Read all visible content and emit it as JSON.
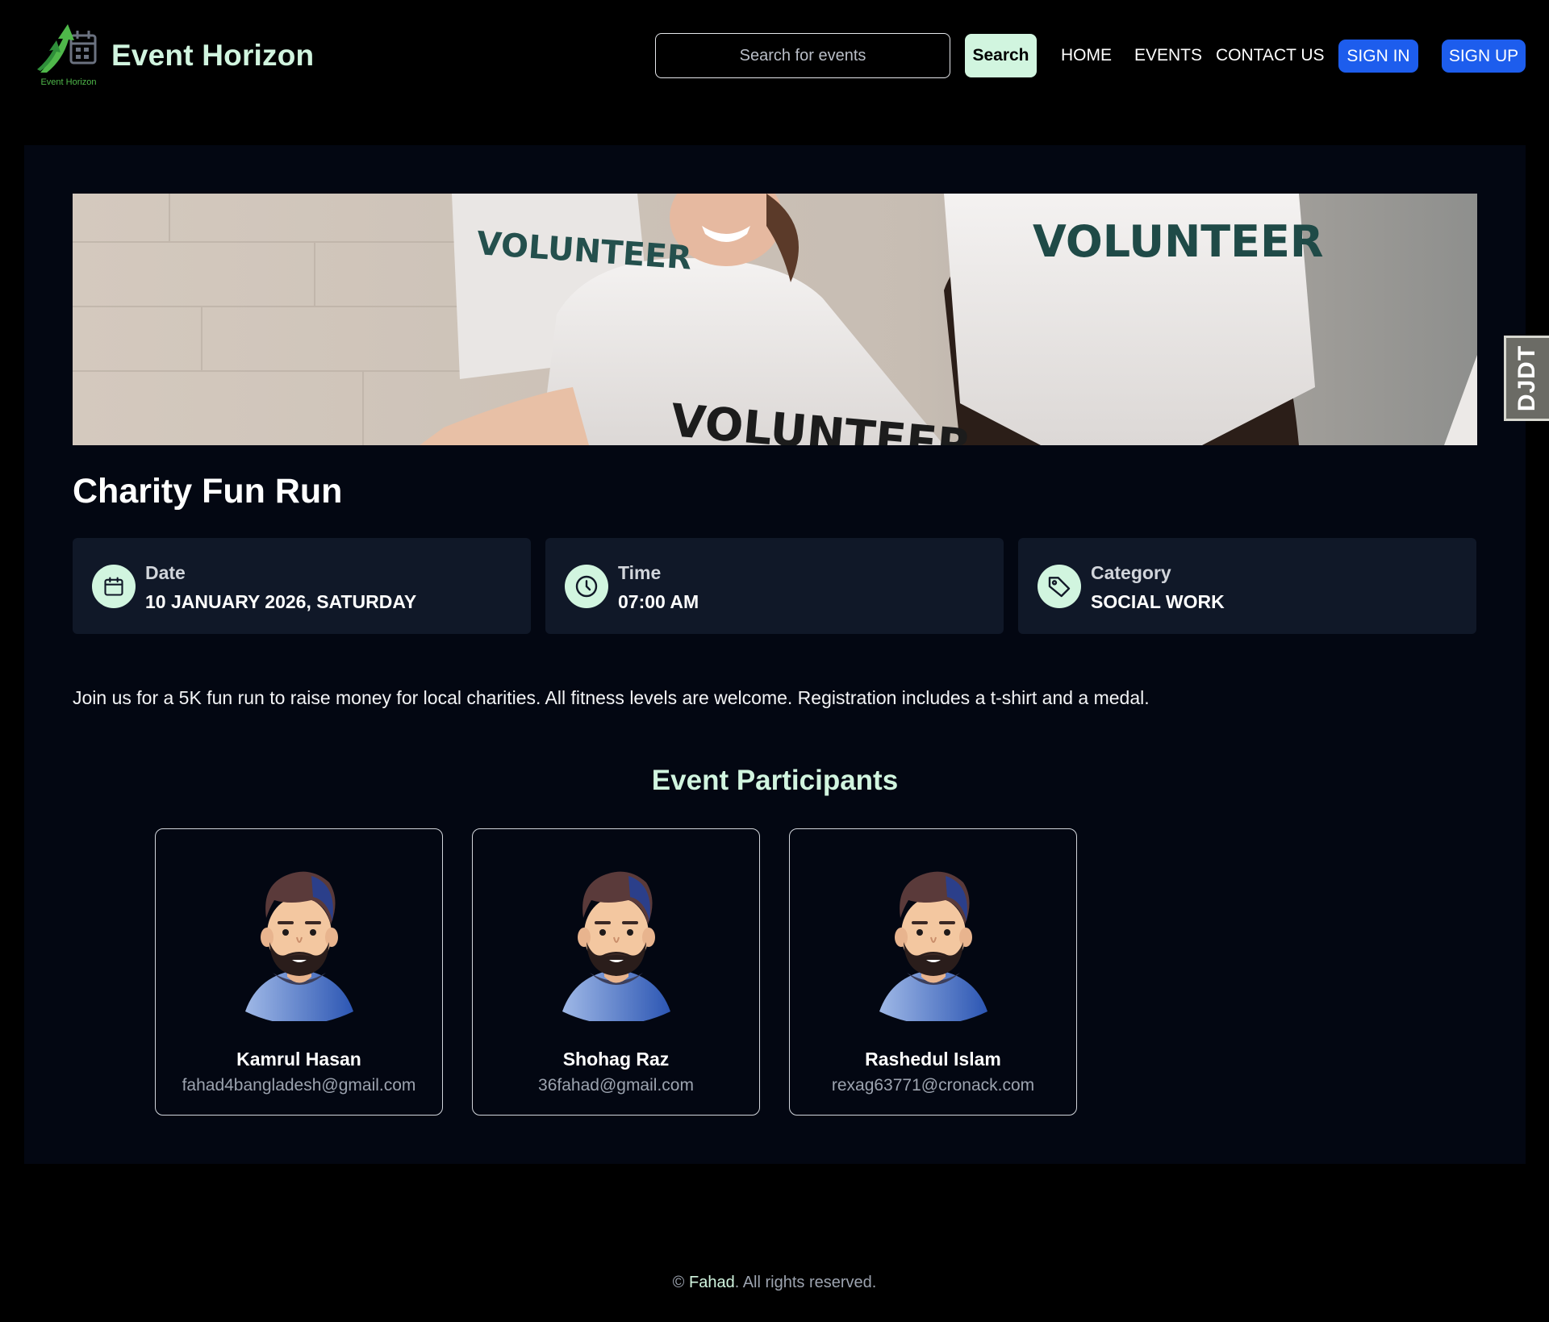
{
  "header": {
    "logo_caption": "Event Horizon",
    "brand": "Event Horizon",
    "search_placeholder": "Search for events",
    "search_button": "Search",
    "nav": {
      "home": "HOME",
      "events": "EVENTS",
      "contact": "CONTACT US"
    },
    "sign_in": "SIGN IN",
    "sign_up": "SIGN UP"
  },
  "event": {
    "banner_icon": "volunteers-photo",
    "title": "Charity Fun Run",
    "info": {
      "date": {
        "label": "Date",
        "value": "10 JANUARY 2026, SATURDAY",
        "icon": "calendar-icon"
      },
      "time": {
        "label": "Time",
        "value": "07:00 AM",
        "icon": "clock-icon"
      },
      "category": {
        "label": "Category",
        "value": "SOCIAL WORK",
        "icon": "tag-icon"
      }
    },
    "description": "Join us for a 5K fun run to raise money for local charities. All fitness levels are welcome. Registration includes a t-shirt and a medal."
  },
  "participants": {
    "heading": "Event Participants",
    "items": [
      {
        "name": "Kamrul Hasan",
        "email": "fahad4bangladesh@gmail.com"
      },
      {
        "name": "Shohag Raz",
        "email": "36fahad@gmail.com"
      },
      {
        "name": "Rashedul Islam",
        "email": "rexag63771@cronack.com"
      }
    ]
  },
  "side_tab": {
    "label": "DJDT"
  },
  "footer": {
    "prefix": "©",
    "author": "Fahad",
    "suffix": ". All rights reserved."
  },
  "colors": {
    "accent": "#d1f5df",
    "primary_button": "#1d5ded",
    "panel": "#030712",
    "card": "#101828"
  }
}
